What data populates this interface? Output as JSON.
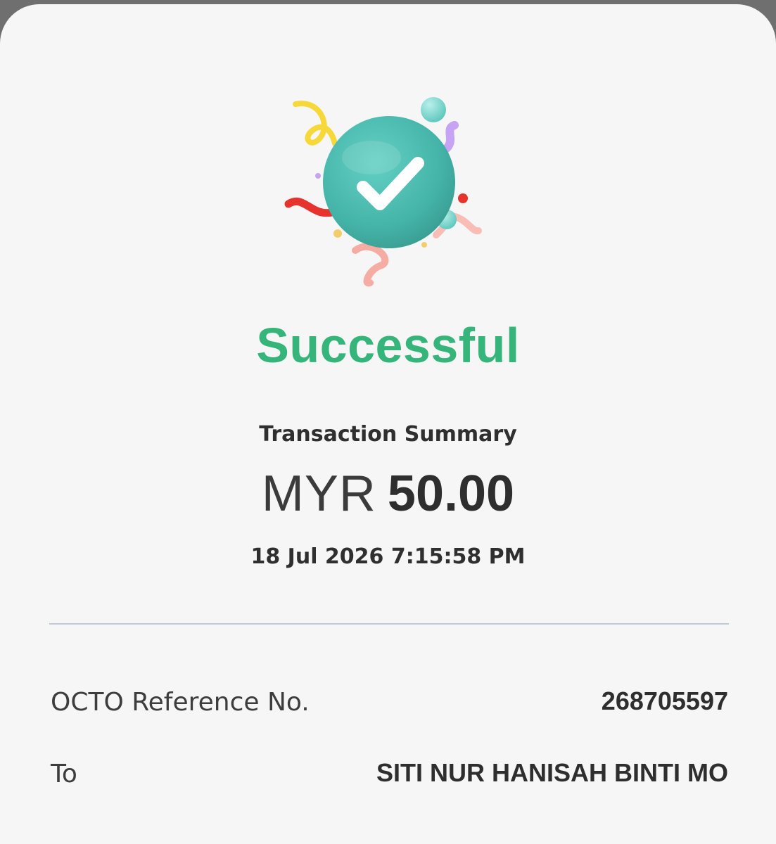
{
  "status": {
    "title": "Successful",
    "color": "#35b57a",
    "icon": "check-circle-icon"
  },
  "summary": {
    "title": "Transaction Summary",
    "currency": "MYR",
    "amount": "50.00",
    "datetime": "18 Jul 2026 7:15:58 PM"
  },
  "details": {
    "reference_label": "OCTO Reference No.",
    "reference_value": "268705597",
    "to_label": "To",
    "to_value": "SITI NUR HANISAH BINTI MO"
  },
  "colors": {
    "accent_teal": "#4dbbb0",
    "success_green": "#35b57a",
    "divider": "#c3c8d6"
  }
}
